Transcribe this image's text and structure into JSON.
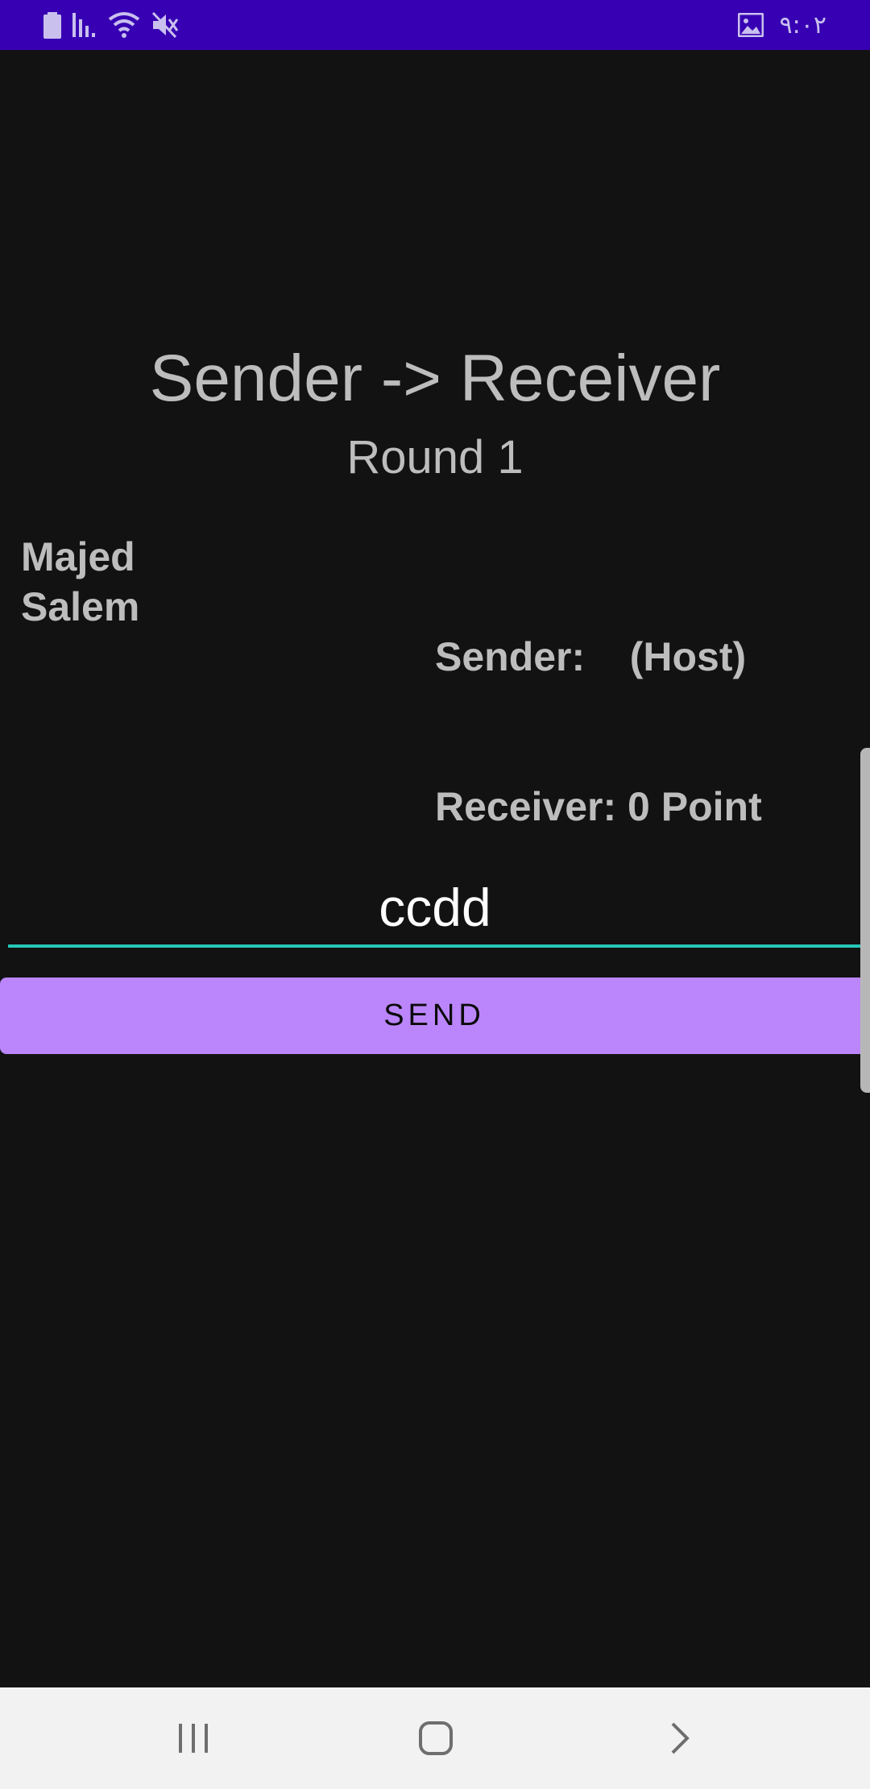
{
  "status_bar": {
    "time": "٩:٠٢",
    "background": "#3700b3",
    "icons_left": [
      "battery-icon",
      "signal-icon",
      "wifi-icon",
      "mute-icon"
    ],
    "icons_right": [
      "image-icon"
    ]
  },
  "game": {
    "title": "Sender -> Receiver",
    "round": "Round 1"
  },
  "players": {
    "names": [
      "Majed",
      "Salem"
    ],
    "roles": [
      "Sender:    (Host)",
      "Receiver: 0 Point"
    ]
  },
  "message": {
    "value": "ccdd",
    "underline_color": "#26c6b6"
  },
  "send_button": {
    "label": "SEND",
    "color": "#bb86fc"
  },
  "nav_bar": {
    "buttons": [
      "recent-apps-icon",
      "home-icon",
      "back-icon"
    ]
  }
}
